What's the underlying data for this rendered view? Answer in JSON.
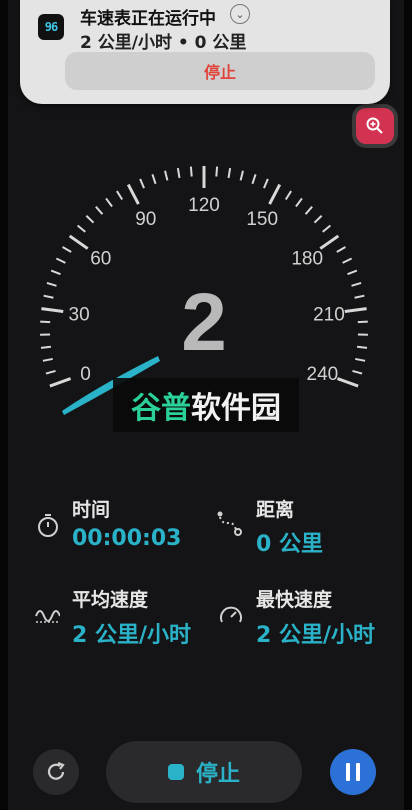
{
  "notification": {
    "app_icon_text": "96",
    "title": "车速表正在运行中",
    "subtitle": "2 公里/小时 • 0 公里",
    "stop_label": "停止"
  },
  "speedometer": {
    "speed": "2",
    "ticks": [
      "0",
      "30",
      "60",
      "90",
      "120",
      "150",
      "180",
      "210",
      "240"
    ],
    "accent": "#2ab3c8"
  },
  "stats": {
    "time": {
      "label": "时间",
      "value": "00:00:03",
      "icon": "stopwatch-icon"
    },
    "distance": {
      "label": "距离",
      "value": "0 公里",
      "icon": "route-icon"
    },
    "avg_speed": {
      "label": "平均速度",
      "value": "2 公里/小时",
      "icon": "wave-icon"
    },
    "max_speed": {
      "label": "最快速度",
      "value": "2 公里/小时",
      "icon": "gauge-icon"
    }
  },
  "controls": {
    "stop_label": "停止"
  },
  "watermark": {
    "part1": "谷普",
    "part2": "软件园"
  }
}
